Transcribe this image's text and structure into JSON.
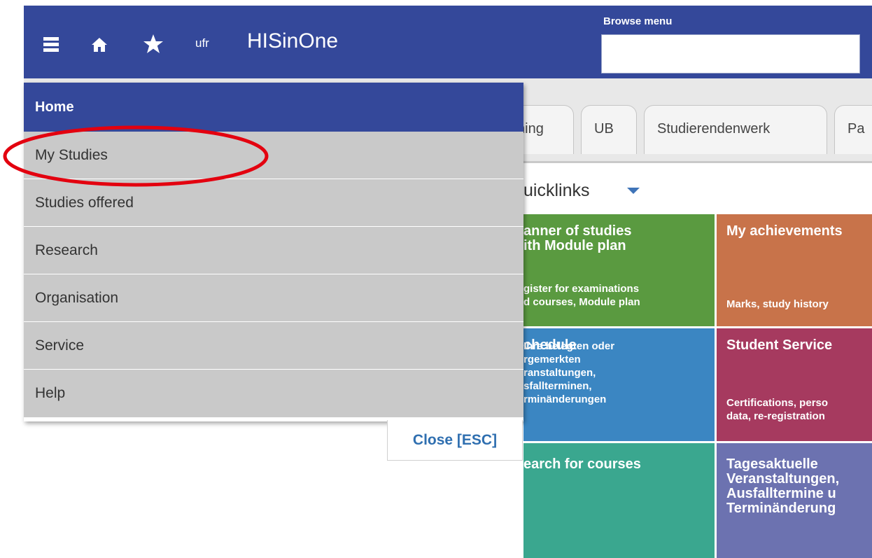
{
  "header": {
    "brand": "HISinOne",
    "logo": "ufr",
    "browse_label": "Browse menu",
    "browse_value": "",
    "icons": [
      "hamburger-icon",
      "home-icon",
      "star-icon"
    ]
  },
  "tabs": [
    {
      "label": "ning"
    },
    {
      "label": "UB"
    },
    {
      "label": "Studierendenwerk"
    },
    {
      "label": "Pa"
    }
  ],
  "quicklinks": {
    "label": "uicklinks"
  },
  "tiles": [
    {
      "title": "anner of studies\nith Module plan",
      "desc": "gister for examinations\nd courses, Module plan",
      "color": "#5a9a40"
    },
    {
      "title": "My achievements",
      "desc": "Marks, study history",
      "color": "#c8734a"
    },
    {
      "title": "chedule",
      "desc": "Ihre belegten oder\nrgemerkten\nranstaltungen,\nsfallterminen,\nrminänderungen",
      "color": "#3b86c2"
    },
    {
      "title": "Student Service",
      "desc": "Certifications, perso\ndata, re-registration",
      "color": "#a63a5f"
    },
    {
      "title": "earch for courses",
      "desc": "",
      "color": "#3aa78f"
    },
    {
      "title": "Tagesaktuelle\nVeranstaltungen,\nAusfalltermine u\nTerminänderung",
      "desc": "",
      "color": "#6c72b0"
    }
  ],
  "menu": {
    "items": [
      {
        "label": "Home"
      },
      {
        "label": "My Studies"
      },
      {
        "label": "Studies offered"
      },
      {
        "label": "Research"
      },
      {
        "label": "Organisation"
      },
      {
        "label": "Service"
      },
      {
        "label": "Help"
      }
    ],
    "close_label": "Close [ESC]"
  },
  "colors": {
    "header_bg": "#34489a",
    "menu_item_bg": "#c9c9c9",
    "highlight": "#e3000f"
  }
}
